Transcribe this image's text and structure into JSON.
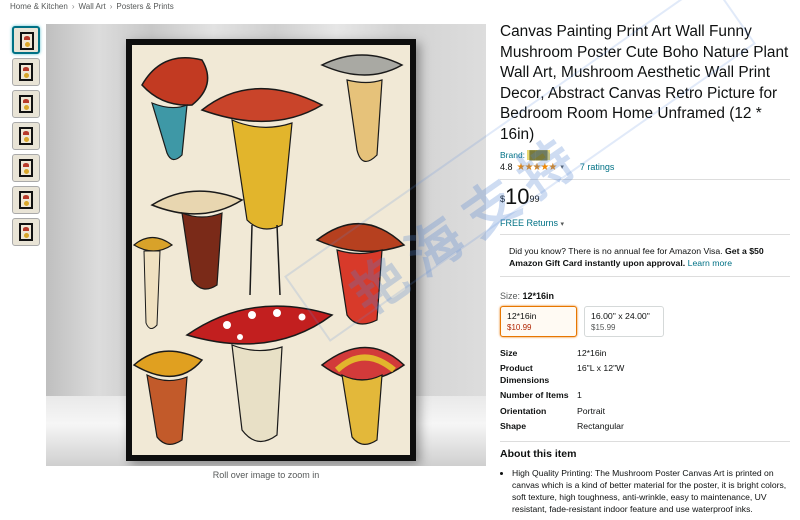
{
  "breadcrumb": [
    "Home & Kitchen",
    "Wall Art",
    "Posters & Prints"
  ],
  "image": {
    "zoom_hint": "Roll over image to zoom in",
    "thumbnail_count": 7
  },
  "product": {
    "title": "Canvas Painting Print Art Wall Funny Mushroom Poster Cute Boho Nature Plant Wall Art, Mushroom Aesthetic Wall Print Decor, Abstract Canvas Retro Picture for Bedroom Room Home Unframed (12 * 16in)",
    "brand_label": "Brand:",
    "brand_value": "███",
    "rating_value": "4.8",
    "stars": "★★★★★",
    "ratings_link": "7 ratings",
    "price": {
      "symbol": "$",
      "whole": "10",
      "fraction": "99"
    },
    "returns": "FREE Returns",
    "promo": {
      "lead": "Did you know? There is no annual fee for Amazon Visa.",
      "bold": "Get a $50 Amazon Gift Card instantly upon approval.",
      "link": "Learn more"
    },
    "size_label": "Size:",
    "size_selected": "12*16in",
    "size_options": [
      {
        "label": "12*16in",
        "price": "$10.99"
      },
      {
        "label": "16.00\" x 24.00\"",
        "price": "$15.99"
      }
    ],
    "specs": [
      {
        "k": "Size",
        "v": "12*16in"
      },
      {
        "k": "Product Dimensions",
        "v": "16\"L x 12\"W"
      },
      {
        "k": "Number of Items",
        "v": "1"
      },
      {
        "k": "Orientation",
        "v": "Portrait"
      },
      {
        "k": "Shape",
        "v": "Rectangular"
      }
    ],
    "about_title": "About this item",
    "about_items": [
      "High Quality Printing: The Mushroom Poster Canvas Art is printed on canvas which is a kind of better material for the poster, it is bright colors, soft texture, high toughness, anti-wrinkle, easy to maintenance, UV resistant, fade-resistant indoor feature and use waterproof inks."
    ]
  },
  "watermark_text": "艳海支持",
  "colors": {
    "link": "#007185",
    "star": "#f08804",
    "price_red": "#b12704",
    "selected_border": "#e77600"
  }
}
